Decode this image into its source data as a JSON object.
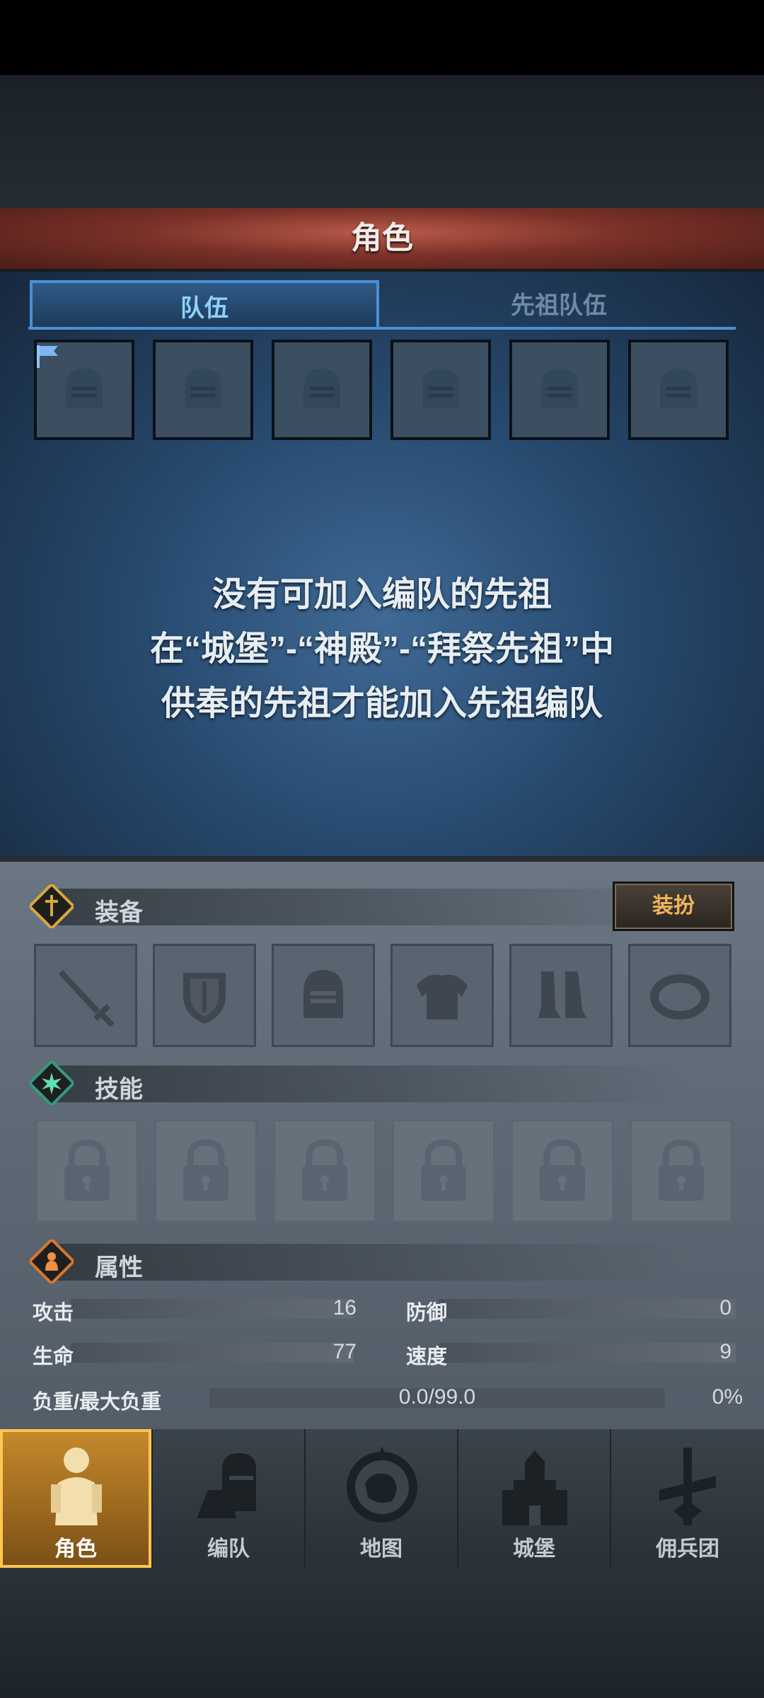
{
  "header": {
    "title": "角色"
  },
  "tabs": [
    {
      "label": "队伍",
      "active": true
    },
    {
      "label": "先祖队伍",
      "active": false
    }
  ],
  "team_slots": {
    "count": 6,
    "icon": "helmet-icon",
    "leader_icon": "flag-icon"
  },
  "message": {
    "line1": "没有可加入编队的先祖",
    "line2": "在“城堡”-“神殿”-“拜祭先祖”中",
    "line3": "供奉的先祖才能加入先祖编队"
  },
  "equipment": {
    "title": "装备",
    "dress_button": "装扮",
    "slots": [
      "sword-icon",
      "shield-icon",
      "helmet-icon",
      "armor-icon",
      "boots-icon",
      "ring-icon"
    ]
  },
  "skills": {
    "title": "技能",
    "slots_locked": 6
  },
  "attributes": {
    "title": "属性",
    "attack_label": "攻击",
    "attack_value": "16",
    "defense_label": "防御",
    "defense_value": "0",
    "hp_label": "生命",
    "hp_value": "77",
    "speed_label": "速度",
    "speed_value": "9",
    "load_label": "负重/最大负重",
    "load_value": "0.0/99.0",
    "load_percent": "0%"
  },
  "nav": [
    {
      "label": "角色",
      "icon": "knight-icon",
      "active": true
    },
    {
      "label": "编队",
      "icon": "squad-icon",
      "active": false
    },
    {
      "label": "地图",
      "icon": "compass-map-icon",
      "active": false
    },
    {
      "label": "城堡",
      "icon": "castle-icon",
      "active": false
    },
    {
      "label": "佣兵团",
      "icon": "mercenary-icon",
      "active": false
    }
  ],
  "colors": {
    "accent_blue": "#4a8fd6",
    "header_red": "#7a3128",
    "nav_active": "#ffc650",
    "dress_text": "#f2b35c"
  }
}
